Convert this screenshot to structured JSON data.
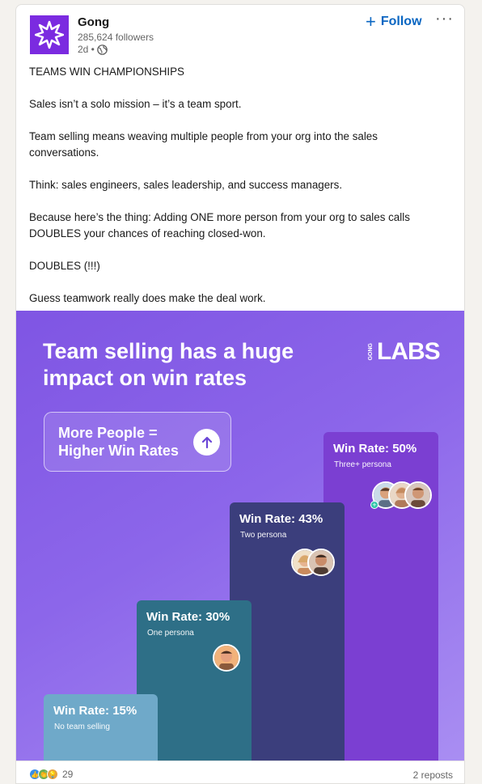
{
  "author": {
    "name": "Gong",
    "followers": "285,624 followers",
    "time": "2d •",
    "follow_label": "Follow",
    "more_label": "···"
  },
  "post": {
    "paragraphs": [
      "TEAMS WIN CHAMPIONSHIPS",
      "Sales isn’t a solo mission – it’s a team sport.",
      "Team selling means weaving multiple people from your org into the sales conversations.",
      "Think: sales engineers, sales leadership, and success managers.",
      "Because here’s the thing: Adding ONE more person from your org to sales calls DOUBLES your chances of reaching closed-won.",
      "DOUBLES (!!!)",
      "Guess teamwork really does make the deal work."
    ]
  },
  "image": {
    "title": "Team selling has a huge impact on win rates",
    "brand_small": "GONG",
    "brand_big": "LABS",
    "pill_text": "More People = Higher Win Rates",
    "bars": [
      {
        "rate": "Win Rate: 15%",
        "sub": "No team selling",
        "color": "#6fa9c9"
      },
      {
        "rate": "Win Rate: 30%",
        "sub": "One persona",
        "color": "#2e6f87"
      },
      {
        "rate": "Win Rate: 43%",
        "sub": "Two persona",
        "color": "#3b3e7c"
      },
      {
        "rate": "Win Rate: 50%",
        "sub": "Three+ persona",
        "color": "#7b3fd2"
      }
    ]
  },
  "social": {
    "reaction_count": "29",
    "reposts": "2 reposts"
  },
  "colors": {
    "accent": "#0a66c2",
    "brand": "#7b2be0"
  }
}
